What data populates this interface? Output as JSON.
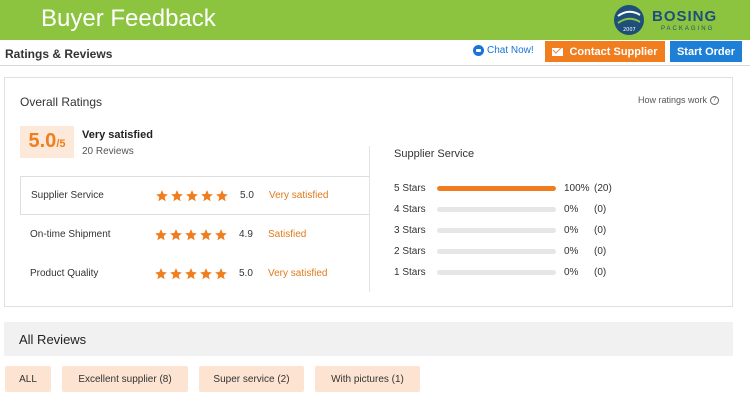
{
  "banner": {
    "title": "Buyer Feedback",
    "logo_name": "BOSING",
    "logo_sub": "PACKAGING",
    "logo_badge": "2007",
    "color": "#8cc43f"
  },
  "header": {
    "title": "Ratings & Reviews",
    "chat_label": "Chat Now!",
    "contact_label": "Contact Supplier",
    "start_order_label": "Start Order",
    "contact_color": "#f07d1e",
    "start_color": "#1e7fd6"
  },
  "overall": {
    "title": "Overall Ratings",
    "how_label": "How ratings work",
    "score": "5.0",
    "score_max": "/5",
    "label": "Very satisfied",
    "count": "20 Reviews",
    "rows": [
      {
        "label": "Supplier Service",
        "stars": 5,
        "score": "5.0",
        "text": "Very satisfied"
      },
      {
        "label": "On-time Shipment",
        "stars": 5,
        "score": "4.9",
        "text": "Satisfied"
      },
      {
        "label": "Product Quality",
        "stars": 5,
        "score": "5.0",
        "text": "Very satisfied"
      }
    ]
  },
  "supplier_service": {
    "title": "Supplier Service",
    "distribution": [
      {
        "label": "5 Stars",
        "percent": 100,
        "pct_text": "100%",
        "count": "(20)"
      },
      {
        "label": "4 Stars",
        "percent": 0,
        "pct_text": "0%",
        "count": "(0)"
      },
      {
        "label": "3 Stars",
        "percent": 0,
        "pct_text": "0%",
        "count": "(0)"
      },
      {
        "label": "2 Stars",
        "percent": 0,
        "pct_text": "0%",
        "count": "(0)"
      },
      {
        "label": "1 Stars",
        "percent": 0,
        "pct_text": "0%",
        "count": "(0)"
      }
    ]
  },
  "reviews": {
    "title": "All Reviews",
    "filters": [
      "ALL",
      "Excellent supplier (8)",
      "Super service (2)",
      "With pictures (1)"
    ]
  },
  "colors": {
    "accent": "#f07d1e",
    "star": "#f07d1e",
    "filter_bg": "#fde4d2"
  }
}
